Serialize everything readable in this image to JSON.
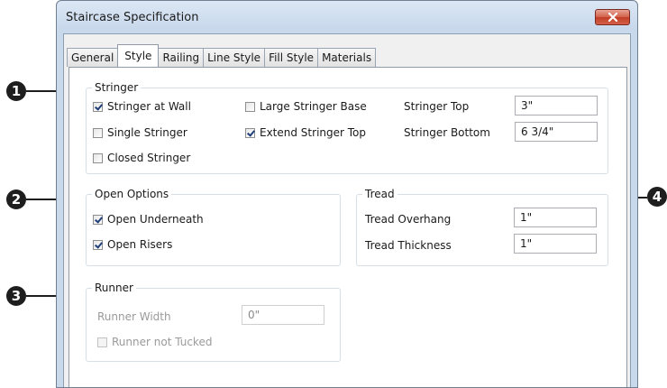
{
  "window": {
    "title": "Staircase Specification"
  },
  "tabs": [
    {
      "label": "General",
      "active": false
    },
    {
      "label": "Style",
      "active": true
    },
    {
      "label": "Railing",
      "active": false
    },
    {
      "label": "Line Style",
      "active": false
    },
    {
      "label": "Fill Style",
      "active": false
    },
    {
      "label": "Materials",
      "active": false
    }
  ],
  "stringer": {
    "title": "Stringer",
    "stringer_at_wall": {
      "label": "Stringer at Wall",
      "checked": true
    },
    "single_stringer": {
      "label": "Single Stringer",
      "checked": false
    },
    "closed_stringer": {
      "label": "Closed Stringer",
      "checked": false
    },
    "large_stringer_base": {
      "label": "Large Stringer Base",
      "checked": false
    },
    "extend_stringer_top": {
      "label": "Extend Stringer Top",
      "checked": true
    },
    "stringer_top": {
      "label": "Stringer Top",
      "value": "3\""
    },
    "stringer_bottom": {
      "label": "Stringer Bottom",
      "value": "6 3/4\""
    }
  },
  "open_options": {
    "title": "Open Options",
    "open_underneath": {
      "label": "Open Underneath",
      "checked": true
    },
    "open_risers": {
      "label": "Open Risers",
      "checked": true
    }
  },
  "tread": {
    "title": "Tread",
    "tread_overhang": {
      "label": "Tread Overhang",
      "value": "1\""
    },
    "tread_thickness": {
      "label": "Tread Thickness",
      "value": "1\""
    }
  },
  "runner": {
    "title": "Runner",
    "runner_width": {
      "label": "Runner Width",
      "value": "0\"",
      "enabled": false
    },
    "runner_not_tucked": {
      "label": "Runner not Tucked",
      "checked": false,
      "enabled": false
    }
  },
  "callouts": [
    "1",
    "2",
    "3",
    "4"
  ],
  "colors": {
    "close_button": "#c23c25",
    "title_bar": "#c9d9ec",
    "checkmark": "#1f3e78",
    "callout": "#1e1e1e"
  }
}
